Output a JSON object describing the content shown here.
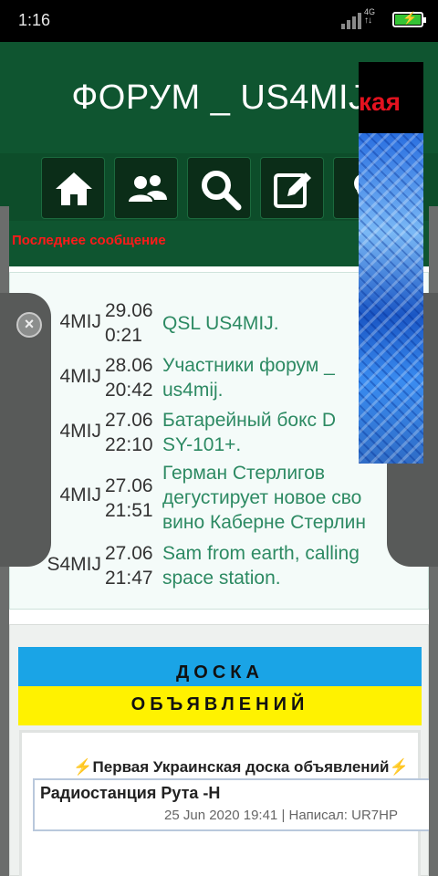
{
  "status_bar": {
    "time": "1:16",
    "network": "4G",
    "network_arrows": "↑↓"
  },
  "header": {
    "title": "ФОРУМ _ US4MIJ"
  },
  "nav": {
    "icons": [
      "home-icon",
      "users-icon",
      "search-icon",
      "edit-icon",
      "more-icon"
    ]
  },
  "section": {
    "label": "Последнее сообщение"
  },
  "posts": [
    {
      "author": "4MIJ",
      "date_line1": "29.06",
      "date_line2": "0:21",
      "title_line1": "QSL US4MIJ.",
      "title_line2": ""
    },
    {
      "author": "4MIJ",
      "date_line1": "28.06",
      "date_line2": "20:42",
      "title_line1": "Участники форум _",
      "title_line2": "us4mij."
    },
    {
      "author": "4MIJ",
      "date_line1": "27.06",
      "date_line2": "22:10",
      "title_line1": "Батарейный бокс D",
      "title_line2": "SY-101+."
    },
    {
      "author": "4MIJ",
      "date_line1": "27.06",
      "date_line2": "21:51",
      "title_line1": "Герман Стерлигов",
      "title_line2": "дегустирует новое сво",
      "title_line3": "вино Каберне Стерлин"
    },
    {
      "author": "S4MIJ",
      "date_line1": "27.06",
      "date_line2": "21:47",
      "title_line1": "Sam from earth, calling",
      "title_line2": "space station."
    }
  ],
  "board": {
    "flag_line1": "ДОСКА",
    "flag_line2": "ОБЪЯВЛЕНИЙ",
    "heading": "⚡Первая Украинская доска объявлений⚡",
    "ad_title": "Радиостанция Рута -Н",
    "ad_meta": "25 Jun 2020 19:41 | Написал: UR7HP"
  },
  "overlay_ad": {
    "text": "кая"
  },
  "colors": {
    "header_green": "#0f5530",
    "link_green": "#2d8a63",
    "section_red": "#ff1a1a",
    "flag_blue": "#1aa4e6",
    "flag_yellow": "#fff200"
  }
}
